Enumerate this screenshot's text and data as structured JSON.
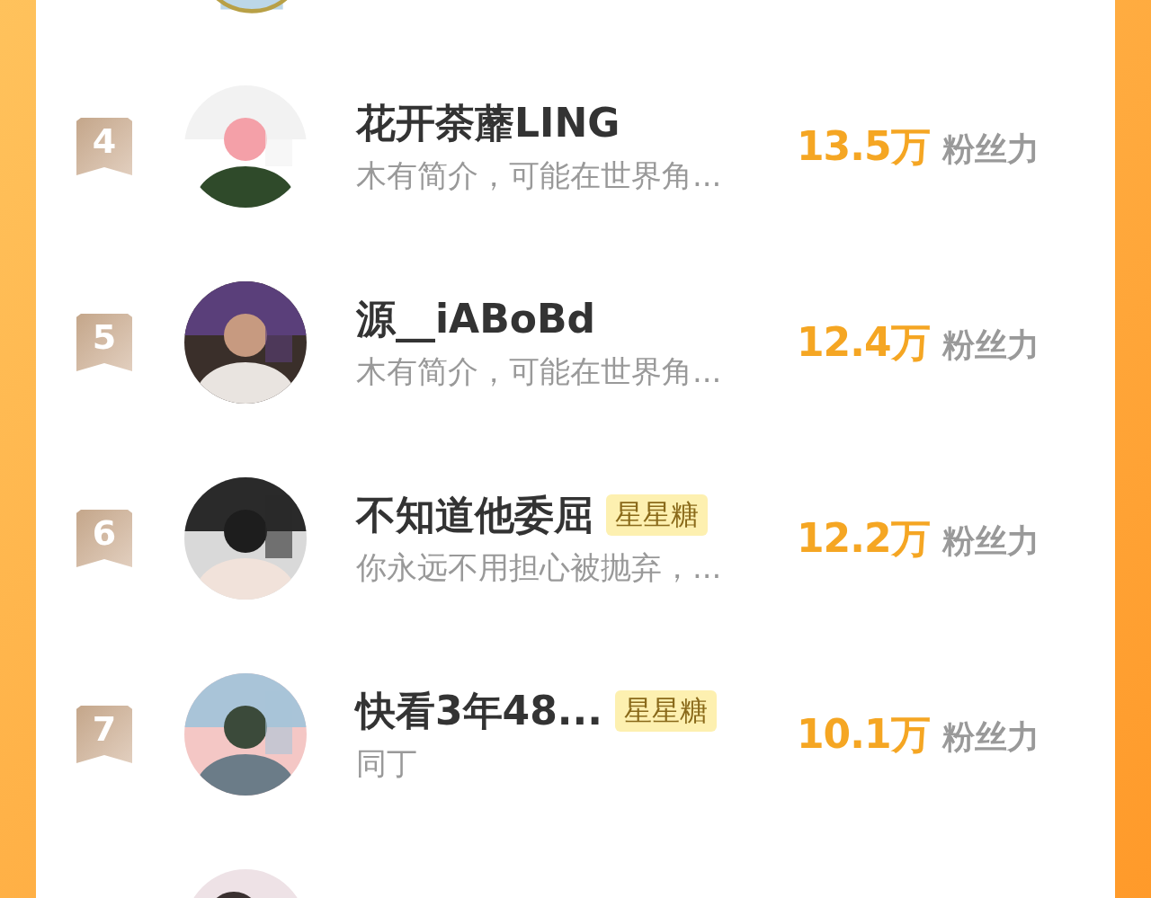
{
  "ranking": [
    {
      "rank": "4",
      "name": "花开荼蘼LING",
      "desc": "木有简介，可能在世界角...",
      "fans": "13.5万",
      "fans_label": "粉丝力"
    },
    {
      "rank": "5",
      "name": "源__iABoBd",
      "desc": "木有简介，可能在世界角...",
      "fans": "12.4万",
      "fans_label": "粉丝力"
    },
    {
      "rank": "6",
      "name": "不知道他委屈",
      "badge": "星星糖",
      "desc": "你永远不用担心被抛弃，...",
      "fans": "12.2万",
      "fans_label": "粉丝力"
    },
    {
      "rank": "7",
      "name": "快看3年48...",
      "badge": "星星糖",
      "desc": "同丁",
      "fans": "10.1万",
      "fans_label": "粉丝力"
    }
  ]
}
